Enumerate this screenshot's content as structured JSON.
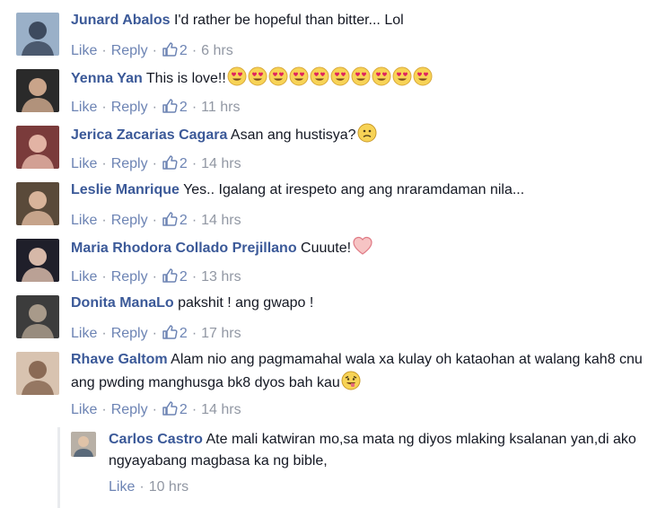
{
  "actions": {
    "like": "Like",
    "reply": "Reply",
    "sep": "·"
  },
  "comments": [
    {
      "name": "Junard Abalos",
      "text": "I'd rather be hopeful than bitter... Lol",
      "likes": "2",
      "time": "6 hrs"
    },
    {
      "name": "Yenna Yan",
      "text": "This is love!!",
      "likes": "2",
      "time": "11 hrs",
      "emoji": "heart-eyes-icon",
      "emoji_count": 10
    },
    {
      "name": "Jerica Zacarias Cagara",
      "text": "Asan ang hustisya?",
      "likes": "2",
      "time": "14 hrs",
      "emoji": "frown-face-icon"
    },
    {
      "name": "Leslie Manrique",
      "text": "Yes.. Igalang at irespeto ang ang nraramdaman nila...",
      "likes": "2",
      "time": "14 hrs"
    },
    {
      "name": "Maria Rhodora Collado Prejillano",
      "text": "Cuuute!",
      "likes": "2",
      "time": "13 hrs",
      "emoji": "heart-icon"
    },
    {
      "name": "Donita ManaLo",
      "text": "pakshit ! ang gwapo !",
      "likes": "2",
      "time": "17 hrs"
    },
    {
      "name": "Rhave Galtom",
      "text": "Alam nio ang pagmamahal wala xa kulay oh kataohan at walang kah8 cnu ang pwding manghusga bk8 dyos bah kau",
      "likes": "2",
      "time": "14 hrs",
      "emoji": "tongue-out-icon"
    }
  ],
  "reply": {
    "name": "Carlos Castro",
    "text": "Ate mali katwiran mo,sa mata ng diyos mlaking ksalanan yan,di ako ngyayabang magbasa ka ng bible,",
    "time": "10 hrs"
  },
  "colors": {
    "name": "#3b5998",
    "link": "#6d84b4",
    "meta": "#9197a3",
    "text": "#141823"
  }
}
